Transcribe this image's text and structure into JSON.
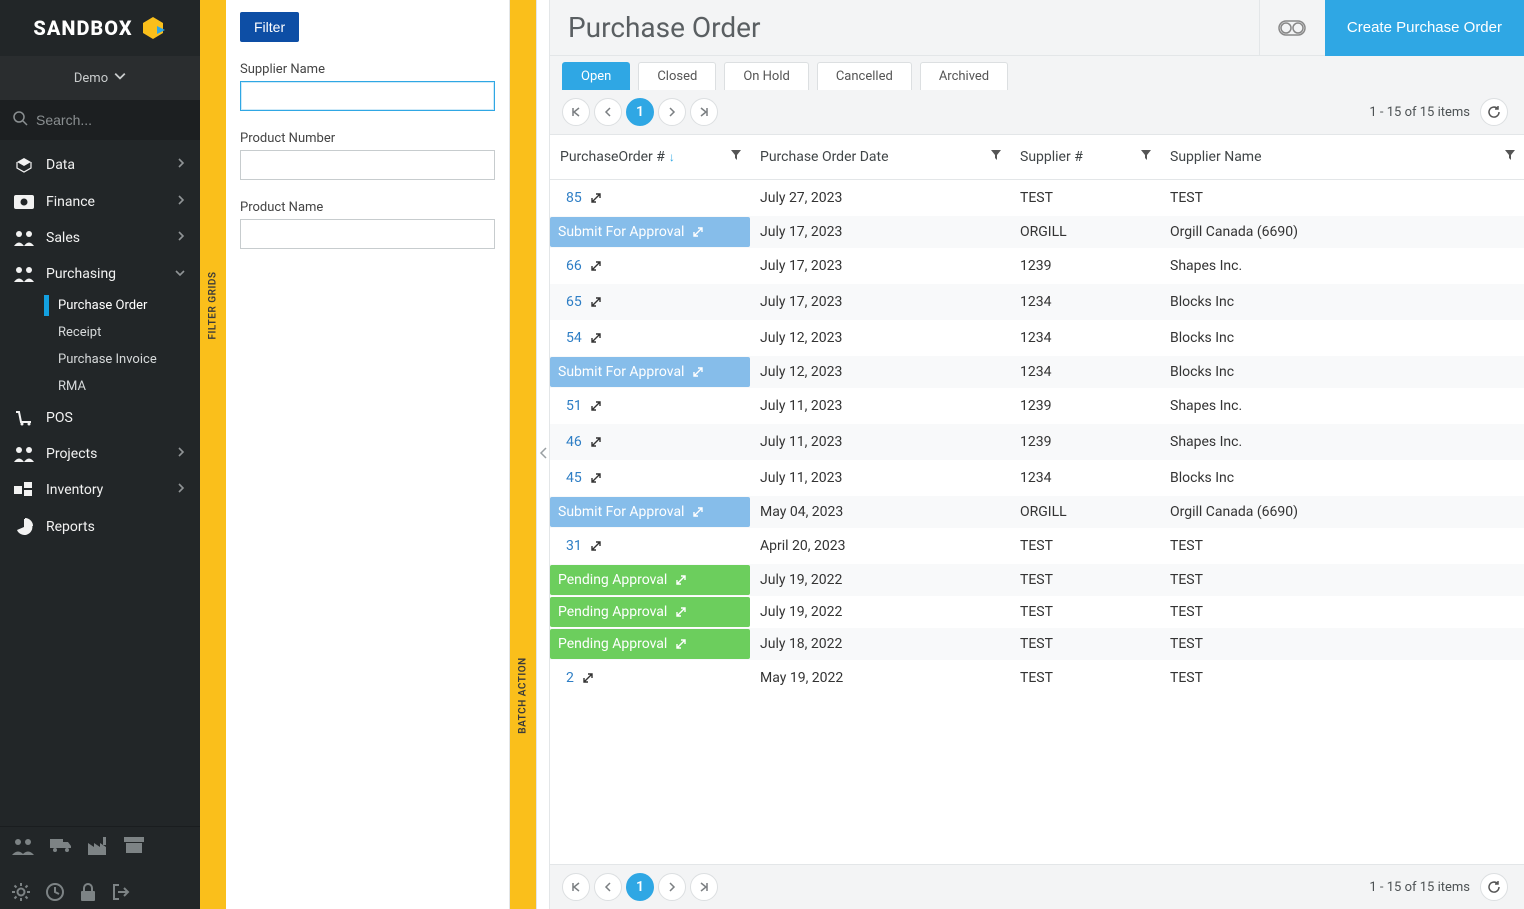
{
  "app": {
    "brand": "SANDBOX",
    "tenant": "Demo",
    "search_placeholder": "Search..."
  },
  "sidebar": {
    "items": [
      {
        "icon": "data",
        "label": "Data",
        "expandable": true
      },
      {
        "icon": "finance",
        "label": "Finance",
        "expandable": true
      },
      {
        "icon": "sales",
        "label": "Sales",
        "expandable": true
      },
      {
        "icon": "purchasing",
        "label": "Purchasing",
        "expandable": true,
        "open": true,
        "children": [
          {
            "label": "Purchase Order",
            "active": true
          },
          {
            "label": "Receipt"
          },
          {
            "label": "Purchase Invoice"
          },
          {
            "label": "RMA"
          }
        ]
      },
      {
        "icon": "pos",
        "label": "POS",
        "expandable": false
      },
      {
        "icon": "projects",
        "label": "Projects",
        "expandable": true
      },
      {
        "icon": "inventory",
        "label": "Inventory",
        "expandable": true
      },
      {
        "icon": "reports",
        "label": "Reports",
        "expandable": false
      }
    ]
  },
  "rails": {
    "filter": "FILTER GRIDS",
    "batch": "BATCH ACTION"
  },
  "filter_panel": {
    "button": "Filter",
    "fields": {
      "supplier_name": "Supplier Name",
      "product_number": "Product Number",
      "product_name": "Product Name"
    }
  },
  "header": {
    "title": "Purchase Order",
    "create": "Create Purchase Order"
  },
  "tabs": [
    "Open",
    "Closed",
    "On Hold",
    "Cancelled",
    "Archived"
  ],
  "active_tab": 0,
  "pager": {
    "page": "1",
    "summary_top": "1 - 15 of 15 items",
    "summary_bottom": "1 - 15 of 15 items"
  },
  "grid": {
    "columns": [
      "PurchaseOrder #",
      "Purchase Order Date",
      "Supplier #",
      "Supplier Name"
    ],
    "sort_col": 0,
    "rows": [
      {
        "po": "85",
        "date": "July 27, 2023",
        "snum": "TEST",
        "sname": "TEST",
        "status": null
      },
      {
        "po": "Submit For Approval",
        "date": "July 17, 2023",
        "snum": "ORGILL",
        "sname": "Orgill Canada (6690)",
        "status": "submit"
      },
      {
        "po": "66",
        "date": "July 17, 2023",
        "snum": "1239",
        "sname": "Shapes Inc.",
        "status": null
      },
      {
        "po": "65",
        "date": "July 17, 2023",
        "snum": "1234",
        "sname": "Blocks Inc",
        "status": null
      },
      {
        "po": "54",
        "date": "July 12, 2023",
        "snum": "1234",
        "sname": "Blocks Inc",
        "status": null
      },
      {
        "po": "Submit For Approval",
        "date": "July 12, 2023",
        "snum": "1234",
        "sname": "Blocks Inc",
        "status": "submit"
      },
      {
        "po": "51",
        "date": "July 11, 2023",
        "snum": "1239",
        "sname": "Shapes Inc.",
        "status": null
      },
      {
        "po": "46",
        "date": "July 11, 2023",
        "snum": "1239",
        "sname": "Shapes Inc.",
        "status": null
      },
      {
        "po": "45",
        "date": "July 11, 2023",
        "snum": "1234",
        "sname": "Blocks Inc",
        "status": null
      },
      {
        "po": "Submit For Approval",
        "date": "May 04, 2023",
        "snum": "ORGILL",
        "sname": "Orgill Canada (6690)",
        "status": "submit"
      },
      {
        "po": "31",
        "date": "April 20, 2023",
        "snum": "TEST",
        "sname": "TEST",
        "status": null
      },
      {
        "po": "Pending Approval",
        "date": "July 19, 2022",
        "snum": "TEST",
        "sname": "TEST",
        "status": "pending"
      },
      {
        "po": "Pending Approval",
        "date": "July 19, 2022",
        "snum": "TEST",
        "sname": "TEST",
        "status": "pending"
      },
      {
        "po": "Pending Approval",
        "date": "July 18, 2022",
        "snum": "TEST",
        "sname": "TEST",
        "status": "pending"
      },
      {
        "po": "2",
        "date": "May 19, 2022",
        "snum": "TEST",
        "sname": "TEST",
        "status": null
      }
    ]
  }
}
